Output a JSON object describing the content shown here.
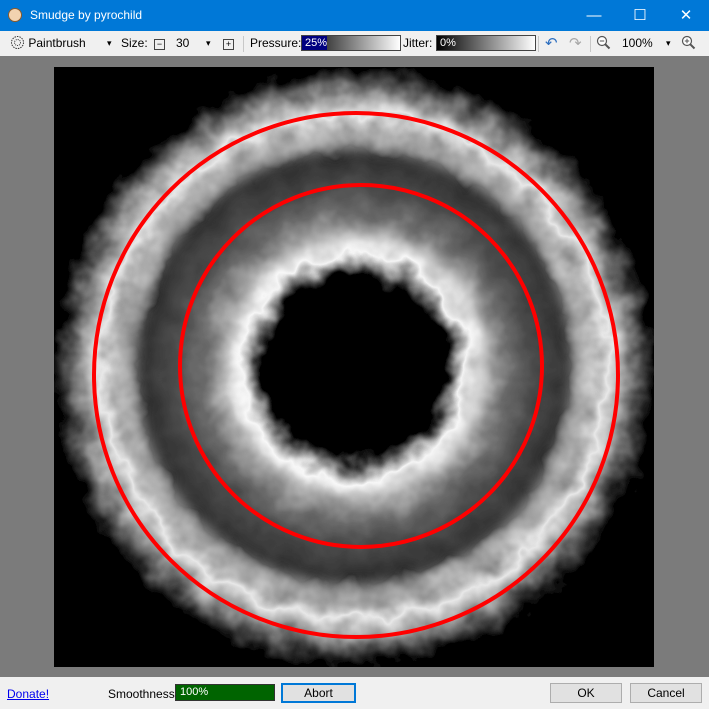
{
  "window": {
    "title": "Smudge by pyrochild",
    "minimize": "—",
    "maximize": "☐",
    "close": "✕"
  },
  "toolbar": {
    "brush": "Paintbrush",
    "size_label": "Size:",
    "size_value": "30",
    "size_decrease": "−",
    "size_increase": "+",
    "dropdown_arrow": "▾",
    "pressure_label": "Pressure:",
    "pressure_value": "25%",
    "pressure_level": 0.25,
    "jitter_label": "Jitter:",
    "jitter_value": "0%",
    "undo": "↶",
    "redo": "↷",
    "zoom_value": "100%"
  },
  "canvas": {
    "background_color": "#7b7b7b",
    "circle_color": "#ff0000"
  },
  "status": {
    "donate": "Donate!",
    "smoothness_label": "Smoothness:",
    "smoothness_value": "100%",
    "smoothness_level": 1.0,
    "abort": "Abort",
    "ok": "OK",
    "cancel": "Cancel"
  },
  "icons": [
    "app-icon",
    "paintbrush-icon",
    "zoom-out-icon",
    "zoom-in-icon",
    "undo-icon",
    "redo-icon"
  ]
}
